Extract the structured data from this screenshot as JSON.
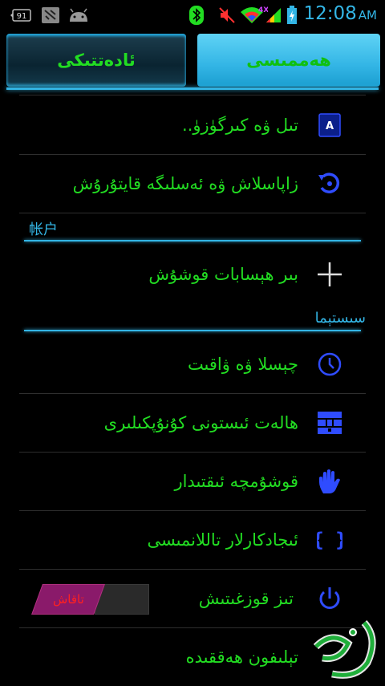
{
  "status_bar": {
    "notification_count": "91",
    "time": "12:08",
    "ampm": "AM",
    "network_badge": "4X",
    "colors": {
      "time": "#33b5e5",
      "bluetooth": "#22dd22",
      "muted": "#ff3030",
      "wifi": "#22dd22"
    }
  },
  "tabs": [
    {
      "label": "ئادەتتىكى",
      "active": false
    },
    {
      "label": "ھەممىسى",
      "active": true
    }
  ],
  "items_personal": [
    {
      "label": "تىل ۋە كىرگۈزۈ..",
      "icon": "language-keyboard-icon"
    },
    {
      "label": "زاپاسلاش ۋە ئەسلىگە قايتۇرۇش",
      "icon": "backup-restore-icon"
    }
  ],
  "section_accounts": {
    "title": "帐户"
  },
  "account_add": {
    "label": "بىر ھېسابات قوشۇش",
    "icon": "plus-icon"
  },
  "section_system": {
    "title": "سىستېما"
  },
  "items_system": [
    {
      "label": "چېسلا ۋە ۋاقىت",
      "icon": "clock-icon"
    },
    {
      "label": "ھالەت ئىستونى كۇنۇپكىلىرى",
      "icon": "status-bar-icon"
    },
    {
      "label": "قوشۇمچە ئىقتىدار",
      "icon": "hand-icon"
    },
    {
      "label": "ئىجادكارلار تاللانمىسى",
      "icon": "braces-icon"
    }
  ],
  "scheduled_power": {
    "label": "تىز قوزغىتىش",
    "toggle_label": "تاقاش",
    "enabled": false
  },
  "about_phone": {
    "label": "تېلىفون ھەققىدە"
  },
  "accent": "#33b5e5",
  "text_color": "#22dd22"
}
